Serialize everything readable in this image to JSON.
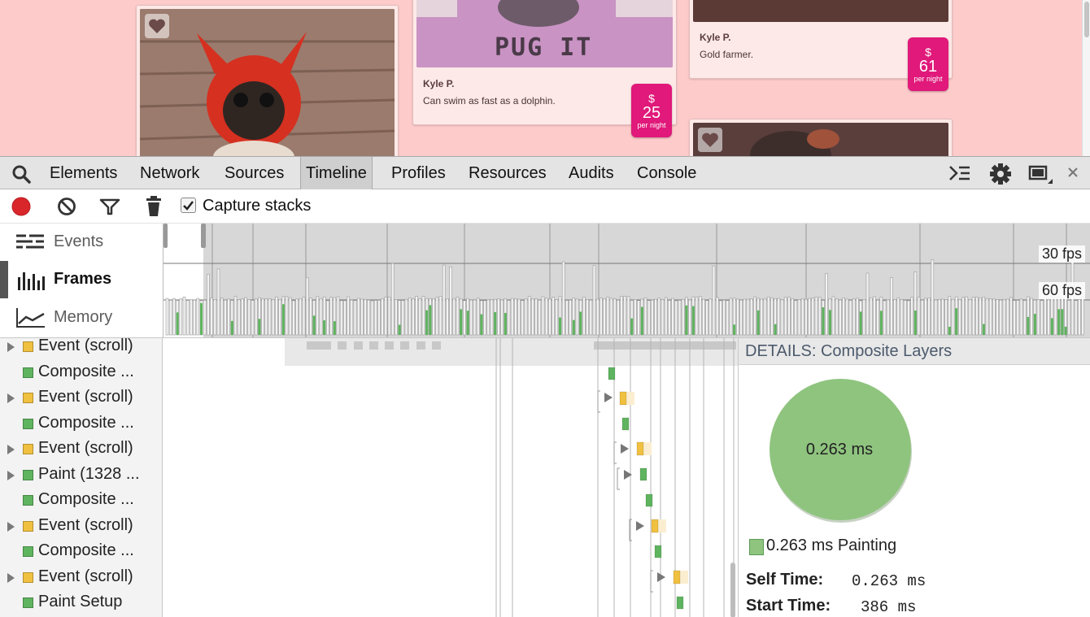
{
  "page_preview": {
    "cards": [
      {
        "owner": "",
        "description": "",
        "price": ""
      },
      {
        "owner": "Kyle P.",
        "description": "Can swim as fast as a dolphin.",
        "price": "25",
        "price_unit": "per night",
        "currency": "$",
        "photo_caption": "PUG IT"
      },
      {
        "owner": "Kyle P.",
        "description": "Gold farmer.",
        "price": "61",
        "price_unit": "per night",
        "currency": "$"
      }
    ]
  },
  "devtools": {
    "tabs": [
      "Elements",
      "Network",
      "Sources",
      "Timeline",
      "Profiles",
      "Resources",
      "Audits",
      "Console"
    ],
    "active_tab": "Timeline",
    "capture_stacks_label": "Capture stacks",
    "capture_stacks_checked": true,
    "nav": [
      {
        "label": "Events",
        "icon": "events-icon"
      },
      {
        "label": "Frames",
        "icon": "frames-icon",
        "selected": true
      },
      {
        "label": "Memory",
        "icon": "memory-icon"
      }
    ],
    "fps_labels": {
      "fps30": "30 fps",
      "fps60": "60 fps"
    },
    "records": [
      {
        "label": "Event (scroll)",
        "color": "#f0c040",
        "expandable": true
      },
      {
        "label": "Composite ...",
        "color": "#5fb45f",
        "expandable": false
      },
      {
        "label": "Event (scroll)",
        "color": "#f0c040",
        "expandable": true
      },
      {
        "label": "Composite ...",
        "color": "#5fb45f",
        "expandable": false
      },
      {
        "label": "Event (scroll)",
        "color": "#f0c040",
        "expandable": true
      },
      {
        "label": "Paint (1328 ...",
        "color": "#5fb45f",
        "expandable": true
      },
      {
        "label": "Composite ...",
        "color": "#5fb45f",
        "expandable": false
      },
      {
        "label": "Event (scroll)",
        "color": "#f0c040",
        "expandable": true
      },
      {
        "label": "Composite ...",
        "color": "#5fb45f",
        "expandable": false
      },
      {
        "label": "Event (scroll)",
        "color": "#f0c040",
        "expandable": true
      },
      {
        "label": "Paint Setup",
        "color": "#5fb45f",
        "expandable": false
      }
    ],
    "details": {
      "title": "DETAILS: Composite Layers",
      "pie_value": "0.263 ms",
      "legend": "0.263 ms Painting",
      "legend_color": "#8fc47f",
      "self_time_label": "Self Time:",
      "self_time_value": "0.263 ms",
      "start_time_label": "Start Time:",
      "start_time_value": "386 ms"
    }
  }
}
